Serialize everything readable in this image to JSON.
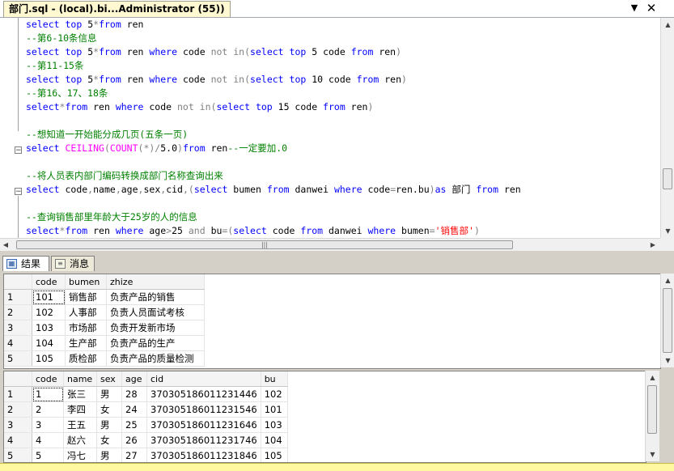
{
  "window": {
    "tab_title": "部门.sql - (local).bi...Administrator (55))",
    "dropdown_icon": "chevron-down-icon",
    "close_icon": "close-icon"
  },
  "editor": {
    "lines": [
      [
        {
          "t": "select",
          "c": "kw"
        },
        {
          "t": " "
        },
        {
          "t": "top",
          "c": "kw"
        },
        {
          "t": " 5"
        },
        {
          "t": "*",
          "c": "op"
        },
        {
          "t": "from",
          "c": "kw"
        },
        {
          "t": " ren"
        }
      ],
      [
        {
          "t": "--第6-10条信息",
          "c": "cm"
        }
      ],
      [
        {
          "t": "select",
          "c": "kw"
        },
        {
          "t": " "
        },
        {
          "t": "top",
          "c": "kw"
        },
        {
          "t": " 5"
        },
        {
          "t": "*",
          "c": "op"
        },
        {
          "t": "from",
          "c": "kw"
        },
        {
          "t": " ren "
        },
        {
          "t": "where",
          "c": "kw"
        },
        {
          "t": " code "
        },
        {
          "t": "not in",
          "c": "op"
        },
        {
          "t": "(",
          "c": "op"
        },
        {
          "t": "select",
          "c": "kw"
        },
        {
          "t": " "
        },
        {
          "t": "top",
          "c": "kw"
        },
        {
          "t": " 5 code "
        },
        {
          "t": "from",
          "c": "kw"
        },
        {
          "t": " ren"
        },
        {
          "t": ")",
          "c": "op"
        }
      ],
      [
        {
          "t": "--第11-15条",
          "c": "cm"
        }
      ],
      [
        {
          "t": "select",
          "c": "kw"
        },
        {
          "t": " "
        },
        {
          "t": "top",
          "c": "kw"
        },
        {
          "t": " 5"
        },
        {
          "t": "*",
          "c": "op"
        },
        {
          "t": "from",
          "c": "kw"
        },
        {
          "t": " ren "
        },
        {
          "t": "where",
          "c": "kw"
        },
        {
          "t": " code "
        },
        {
          "t": "not in",
          "c": "op"
        },
        {
          "t": "(",
          "c": "op"
        },
        {
          "t": "select",
          "c": "kw"
        },
        {
          "t": " "
        },
        {
          "t": "top",
          "c": "kw"
        },
        {
          "t": " 10 code "
        },
        {
          "t": "from",
          "c": "kw"
        },
        {
          "t": " ren"
        },
        {
          "t": ")",
          "c": "op"
        }
      ],
      [
        {
          "t": "--第16、17、18条",
          "c": "cm"
        }
      ],
      [
        {
          "t": "select",
          "c": "kw"
        },
        {
          "t": "*",
          "c": "op"
        },
        {
          "t": "from",
          "c": "kw"
        },
        {
          "t": " ren "
        },
        {
          "t": "where",
          "c": "kw"
        },
        {
          "t": " code "
        },
        {
          "t": "not in",
          "c": "op"
        },
        {
          "t": "(",
          "c": "op"
        },
        {
          "t": "select",
          "c": "kw"
        },
        {
          "t": " "
        },
        {
          "t": "top",
          "c": "kw"
        },
        {
          "t": " 15 code "
        },
        {
          "t": "from",
          "c": "kw"
        },
        {
          "t": " ren"
        },
        {
          "t": ")",
          "c": "op"
        }
      ],
      [],
      [
        {
          "t": "--想知道一开始能分成几页(五条一页)",
          "c": "cm"
        }
      ],
      [
        {
          "t": "select",
          "c": "kw"
        },
        {
          "t": " "
        },
        {
          "t": "CEILING",
          "c": "fn"
        },
        {
          "t": "(",
          "c": "op"
        },
        {
          "t": "COUNT",
          "c": "fn"
        },
        {
          "t": "(*)/",
          "c": "op"
        },
        {
          "t": "5.0"
        },
        {
          "t": ")",
          "c": "op"
        },
        {
          "t": "from",
          "c": "kw"
        },
        {
          "t": " ren"
        },
        {
          "t": "--一定要加.0",
          "c": "cm"
        }
      ],
      [],
      [
        {
          "t": "--将人员表内部门编码转换成部门名称查询出来",
          "c": "cm"
        }
      ],
      [
        {
          "t": "select",
          "c": "kw"
        },
        {
          "t": " code"
        },
        {
          "t": ",",
          "c": "op"
        },
        {
          "t": "name"
        },
        {
          "t": ",",
          "c": "op"
        },
        {
          "t": "age"
        },
        {
          "t": ",",
          "c": "op"
        },
        {
          "t": "sex"
        },
        {
          "t": ",",
          "c": "op"
        },
        {
          "t": "cid"
        },
        {
          "t": ",(",
          "c": "op"
        },
        {
          "t": "select",
          "c": "kw"
        },
        {
          "t": " bumen "
        },
        {
          "t": "from",
          "c": "kw"
        },
        {
          "t": " danwei "
        },
        {
          "t": "where",
          "c": "kw"
        },
        {
          "t": " code"
        },
        {
          "t": "=",
          "c": "op"
        },
        {
          "t": "ren.bu"
        },
        {
          "t": ")",
          "c": "op"
        },
        {
          "t": "as",
          "c": "kw"
        },
        {
          "t": " 部门 "
        },
        {
          "t": "from",
          "c": "kw"
        },
        {
          "t": " ren"
        }
      ],
      [],
      [
        {
          "t": "--查询销售部里年龄大于25岁的人的信息",
          "c": "cm"
        }
      ],
      [
        {
          "t": "select",
          "c": "kw"
        },
        {
          "t": "*",
          "c": "op"
        },
        {
          "t": "from",
          "c": "kw"
        },
        {
          "t": " ren "
        },
        {
          "t": "where",
          "c": "kw"
        },
        {
          "t": " age"
        },
        {
          "t": ">",
          "c": "op"
        },
        {
          "t": "25 "
        },
        {
          "t": "and",
          "c": "op"
        },
        {
          "t": " bu"
        },
        {
          "t": "=(",
          "c": "op"
        },
        {
          "t": "select",
          "c": "kw"
        },
        {
          "t": " code "
        },
        {
          "t": "from",
          "c": "kw"
        },
        {
          "t": " danwei "
        },
        {
          "t": "where",
          "c": "kw"
        },
        {
          "t": " bumen"
        },
        {
          "t": "=",
          "c": "op"
        },
        {
          "t": "'销售部'",
          "c": "str"
        },
        {
          "t": ")",
          "c": "op"
        }
      ]
    ],
    "hscroll_grip": "|||"
  },
  "results_tabs": [
    {
      "label": "结果",
      "icon": "grid-icon",
      "active": true
    },
    {
      "label": "消息",
      "icon": "message-icon",
      "active": false
    }
  ],
  "grid1": {
    "columns": [
      "code",
      "bumen",
      "zhize"
    ],
    "rows": [
      [
        "1",
        "101",
        "销售部",
        "负责产品的销售"
      ],
      [
        "2",
        "102",
        "人事部",
        "负责人员面试考核"
      ],
      [
        "3",
        "103",
        "市场部",
        "负责开发新市场"
      ],
      [
        "4",
        "104",
        "生产部",
        "负责产品的生产"
      ],
      [
        "5",
        "105",
        "质检部",
        "负责产品的质量检测"
      ]
    ]
  },
  "grid2": {
    "columns": [
      "code",
      "name",
      "sex",
      "age",
      "cid",
      "bu"
    ],
    "rows": [
      [
        "1",
        "1",
        "张三",
        "男",
        "28",
        "370305186011231446",
        "102"
      ],
      [
        "2",
        "2",
        "李四",
        "女",
        "24",
        "370305186011231546",
        "101"
      ],
      [
        "3",
        "3",
        "王五",
        "男",
        "25",
        "370305186011231646",
        "103"
      ],
      [
        "4",
        "4",
        "赵六",
        "女",
        "26",
        "370305186011231746",
        "104"
      ],
      [
        "5",
        "5",
        "冯七",
        "男",
        "27",
        "370305186011231846",
        "105"
      ]
    ]
  }
}
